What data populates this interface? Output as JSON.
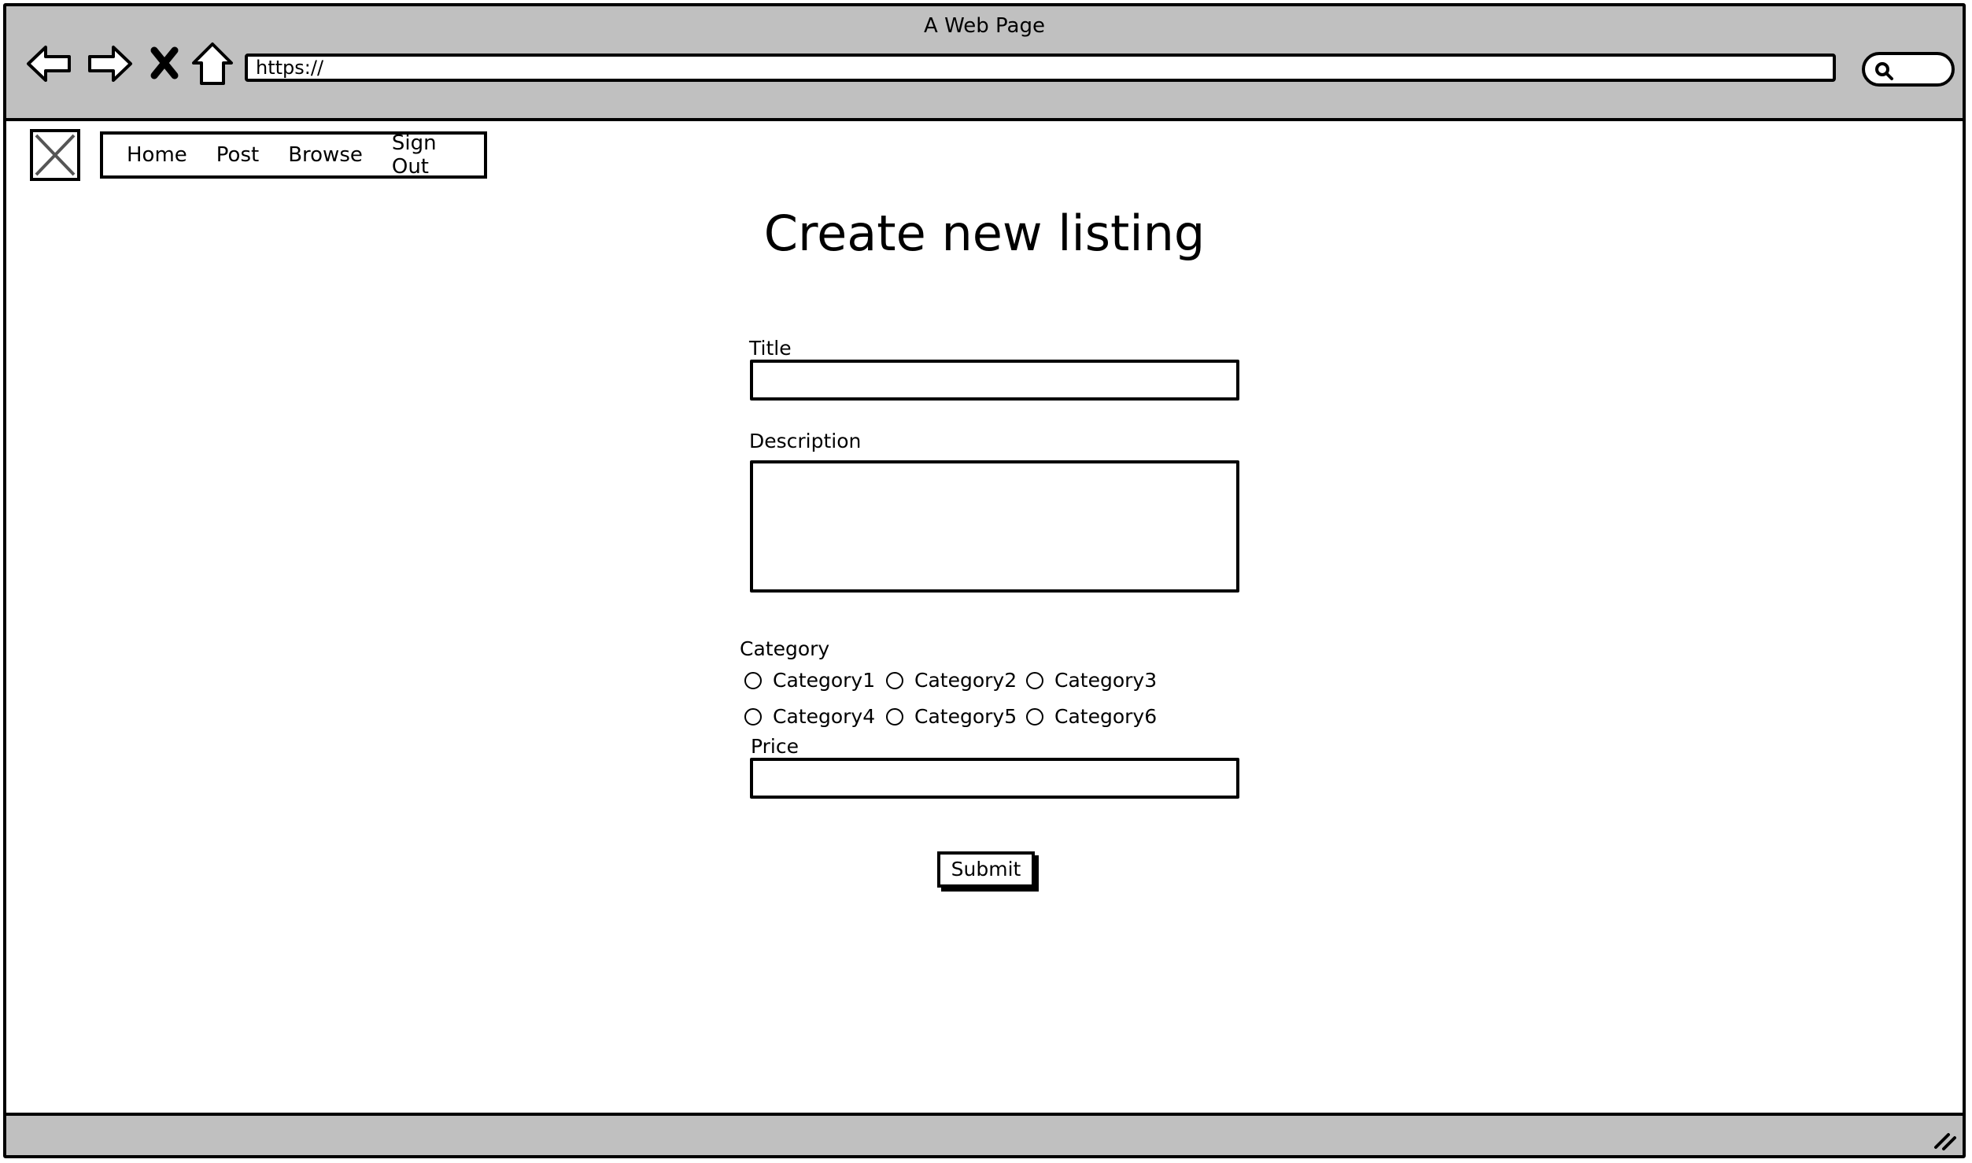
{
  "window": {
    "title": "A Web Page"
  },
  "browser": {
    "url": "https://",
    "icons": [
      "back-arrow-icon",
      "forward-arrow-icon",
      "close-icon",
      "home-icon",
      "search-icon"
    ]
  },
  "nav": {
    "items": [
      "Home",
      "Post",
      "Browse",
      "Sign Out"
    ]
  },
  "page": {
    "heading": "Create new listing"
  },
  "form": {
    "title_label": "Title",
    "title_value": "",
    "description_label": "Description",
    "description_value": "",
    "category_label": "Category",
    "categories": [
      "Category1",
      "Category2",
      "Category3",
      "Category4",
      "Category5",
      "Category6"
    ],
    "price_label": "Price",
    "price_value": "",
    "submit_label": "Submit"
  }
}
